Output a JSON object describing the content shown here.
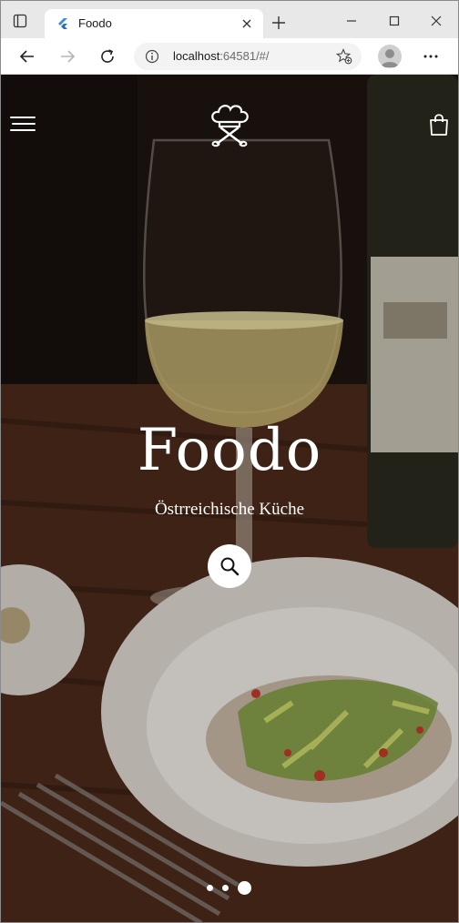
{
  "browser": {
    "tab_title": "Foodo",
    "url_host": "localhost",
    "url_rest": ":64581/#/"
  },
  "hero": {
    "title": "Foodo",
    "subtitle": "Östrreichische Küche",
    "carousel": {
      "count": 3,
      "active_index": 2
    }
  },
  "icons": {
    "menu": "hamburger-menu-icon",
    "logo": "chef-hat-logo-icon",
    "cart": "shopping-bag-icon",
    "search": "search-icon"
  },
  "colors": {
    "accent": "#ffffff",
    "tab_favicon": "#3b8fd9"
  }
}
